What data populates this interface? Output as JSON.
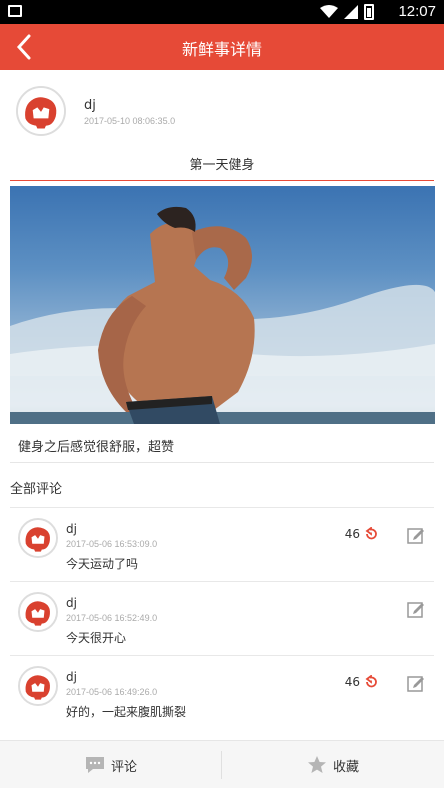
{
  "status_bar": {
    "time": "12:07",
    "icons": [
      "image-icon",
      "wifi-icon",
      "signal-icon",
      "battery-icon"
    ]
  },
  "header": {
    "title": "新鲜事详情",
    "back_icon": "chevron-left-icon",
    "color": "#e64a37"
  },
  "post": {
    "author": "dj",
    "time": "2017-05-10 08:06:35.0",
    "title": "第一天健身",
    "image_alt": "man-flexing-photo",
    "body": "健身之后感觉很舒服，超赞"
  },
  "comments_section": {
    "title": "全部评论",
    "items": [
      {
        "author": "dj",
        "time": "2017-05-06 16:53:09.0",
        "text": "今天运动了吗",
        "likes": "46"
      },
      {
        "author": "dj",
        "time": "2017-05-06 16:52:49.0",
        "text": "今天很开心",
        "likes": ""
      },
      {
        "author": "dj",
        "time": "2017-05-06 16:49:26.0",
        "text": "好的，一起来腹肌撕裂",
        "likes": "46"
      }
    ]
  },
  "bottom_bar": {
    "comment_label": "评论",
    "favorite_label": "收藏"
  }
}
